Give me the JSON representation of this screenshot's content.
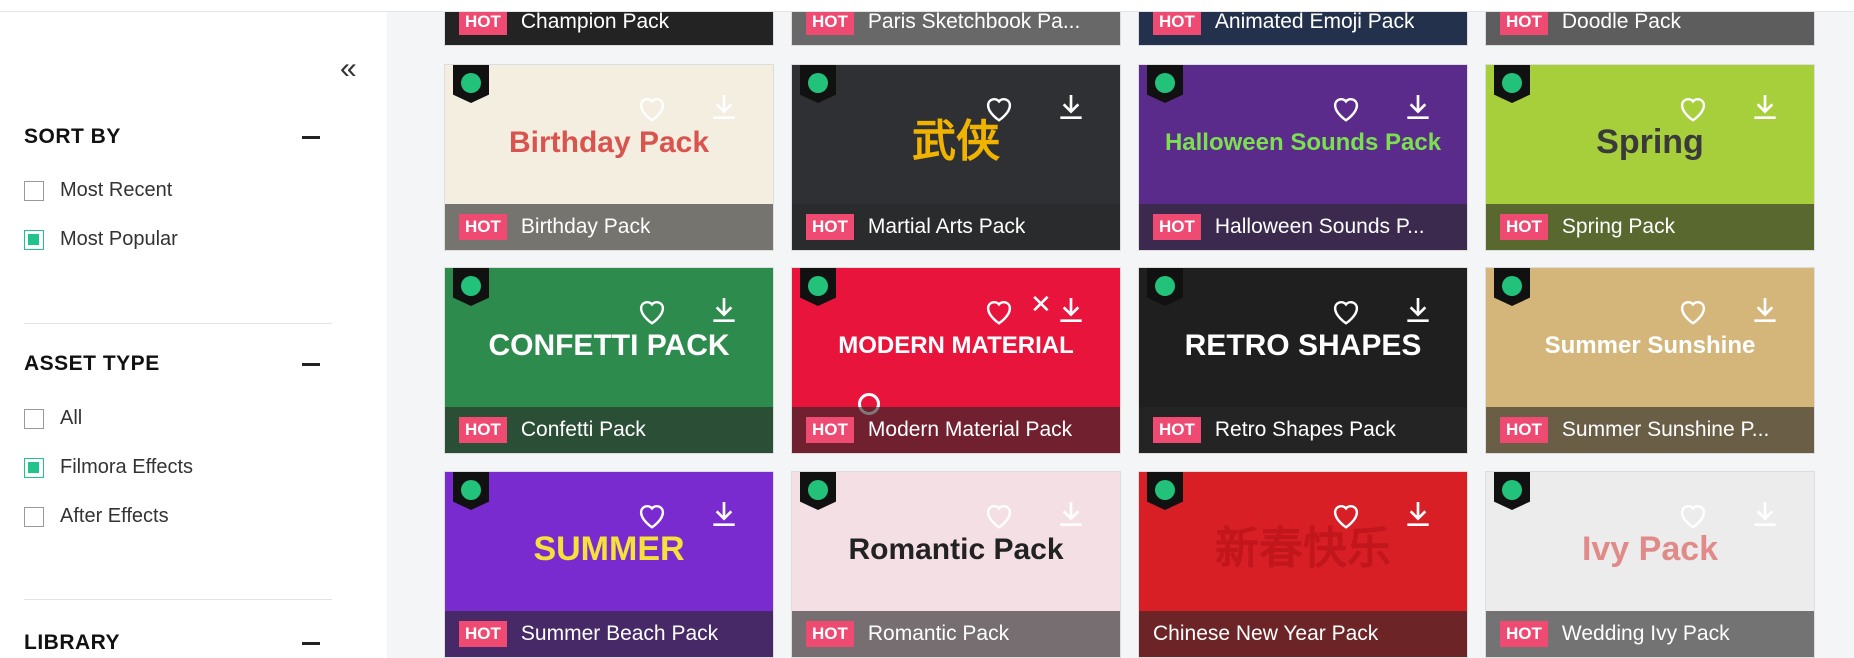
{
  "sidebar": {
    "collapse_icon": "double-chevron-left-icon",
    "sort_by": {
      "title": "SORT BY",
      "options": [
        {
          "label": "Most Recent",
          "checked": false
        },
        {
          "label": "Most Popular",
          "checked": true
        }
      ]
    },
    "asset_type": {
      "title": "ASSET TYPE",
      "options": [
        {
          "label": "All",
          "checked": false
        },
        {
          "label": "Filmora Effects",
          "checked": true
        },
        {
          "label": "After Effects",
          "checked": false
        }
      ]
    },
    "library": {
      "title": "LIBRARY"
    }
  },
  "colors": {
    "accent": "#20c38a",
    "hot": "#ee4a72"
  },
  "grid": {
    "hot_label": "HOT",
    "cards": [
      {
        "title": "Champion Pack",
        "hot": true,
        "bg": "#1b1b1b"
      },
      {
        "title": "Paris Sketchbook Pa...",
        "hot": true,
        "bg": "#cfcfcf"
      },
      {
        "title": "Animated Emoji Pack",
        "hot": true,
        "bg": "#1e3f8a"
      },
      {
        "title": "Doodle Pack",
        "hot": true,
        "bg": "#b4b4b4"
      },
      {
        "title": "Birthday Pack",
        "hot": true,
        "bg": "#f3eedf",
        "art": "Birthday Pack",
        "art_color": "#d9534f"
      },
      {
        "title": "Martial Arts Pack",
        "hot": true,
        "bg": "#2e3033",
        "art": "武侠",
        "art_color": "#f0b400"
      },
      {
        "title": "Halloween Sounds P...",
        "hot": true,
        "bg": "#5b2b8c",
        "art": "Halloween Sounds Pack",
        "art_color": "#7be04f"
      },
      {
        "title": "Spring Pack",
        "hot": true,
        "bg": "#a7cf3c",
        "art": "Spring",
        "art_color": "#3a3a3a"
      },
      {
        "title": "Confetti Pack",
        "hot": true,
        "bg": "#2e8b4e",
        "art": "CONFETTI PACK",
        "art_color": "#ffffff"
      },
      {
        "title": "Modern Material Pack",
        "hot": true,
        "bg": "#e8143c",
        "art": "MODERN MATERIAL",
        "art_color": "#ffffff"
      },
      {
        "title": "Retro Shapes Pack",
        "hot": true,
        "bg": "#1f1f1f",
        "art": "RETRO SHAPES",
        "art_color": "#ffffff"
      },
      {
        "title": "Summer Sunshine P...",
        "hot": true,
        "bg": "#d4b67a",
        "art": "Summer Sunshine",
        "art_color": "#ffffff"
      },
      {
        "title": "Summer Beach Pack",
        "hot": true,
        "bg": "#7a2bd0",
        "art": "SUMMER",
        "art_color": "#f4e13a"
      },
      {
        "title": "Romantic Pack",
        "hot": true,
        "bg": "#f4dfe4",
        "art": "Romantic Pack",
        "art_color": "#222222"
      },
      {
        "title": "Chinese New Year Pack",
        "hot": false,
        "bg": "#d91f26",
        "art": "新春快乐",
        "art_color": "#c0161c"
      },
      {
        "title": "Wedding Ivy Pack",
        "hot": true,
        "bg": "#ececec",
        "art": "Ivy Pack",
        "art_color": "#e08a8a"
      }
    ]
  }
}
